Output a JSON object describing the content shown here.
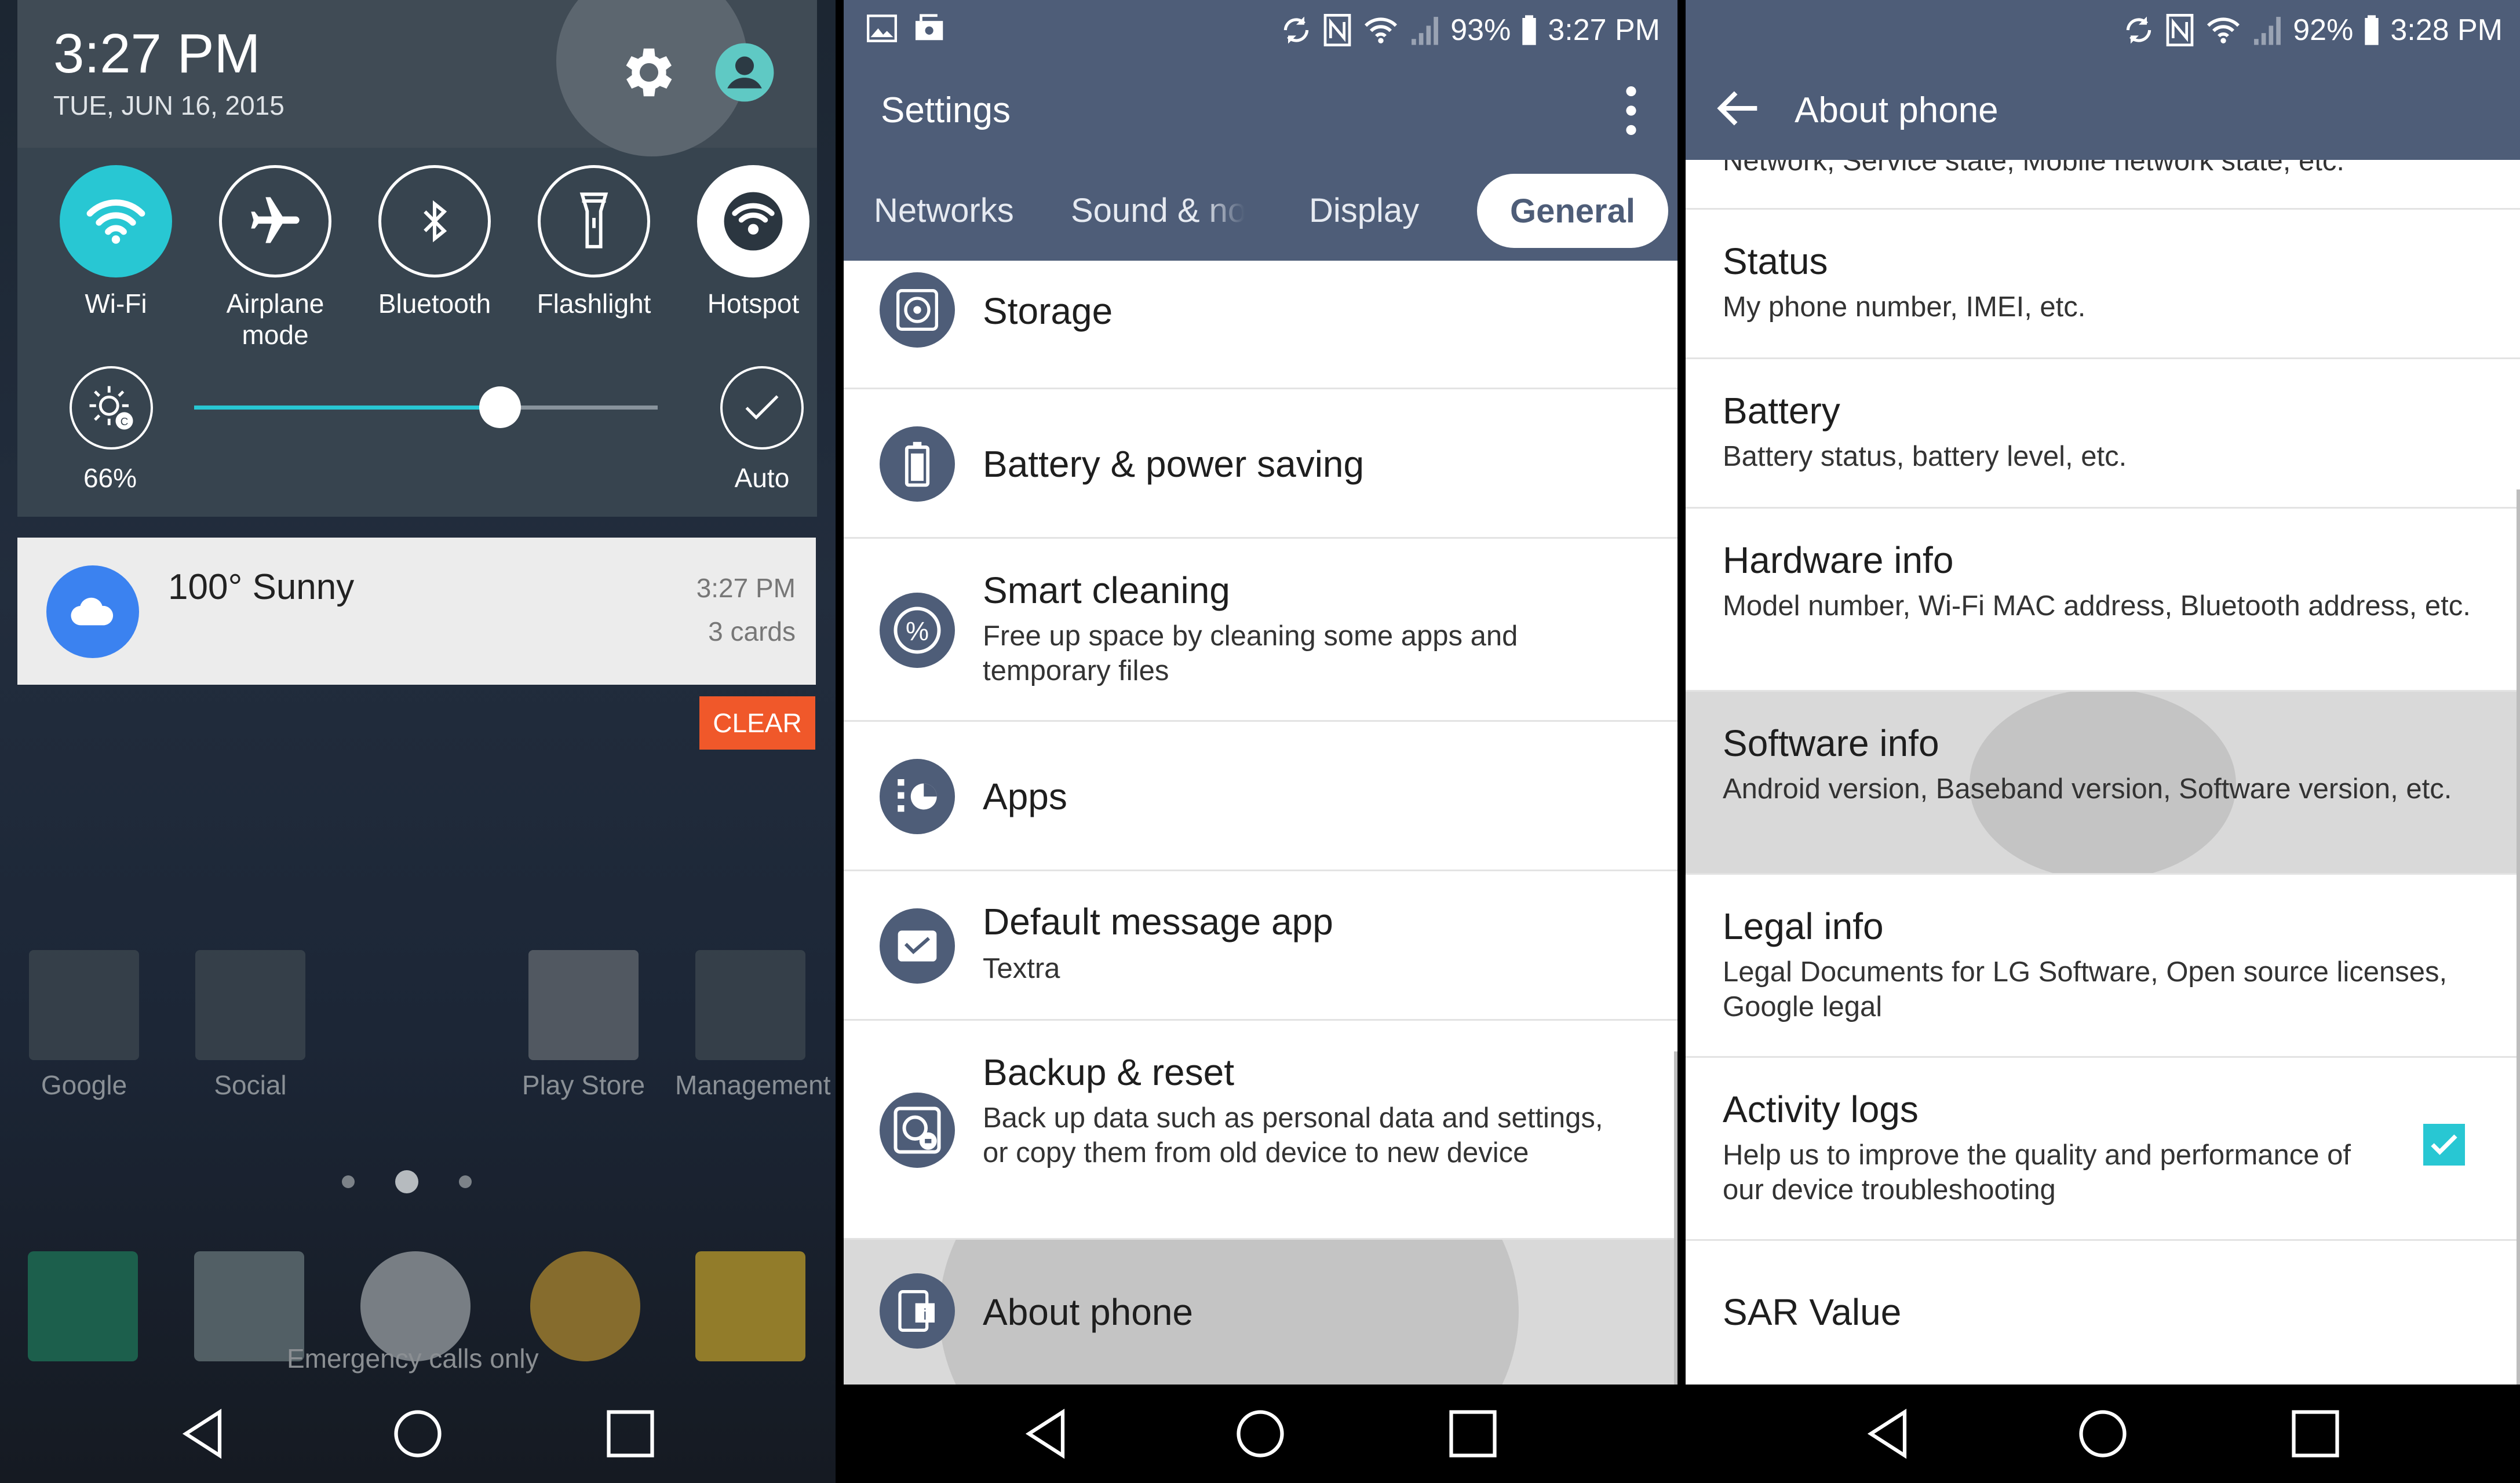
{
  "panel1": {
    "time": "3:27 PM",
    "date": "TUE, JUN 16, 2015",
    "quick_toggles": [
      {
        "label": "Wi-Fi",
        "icon": "wifi-icon",
        "active": true
      },
      {
        "label": "Airplane mode",
        "icon": "airplane-icon",
        "active": false
      },
      {
        "label": "Bluetooth",
        "icon": "bluetooth-icon",
        "active": false
      },
      {
        "label": "Flashlight",
        "icon": "flashlight-icon",
        "active": false
      },
      {
        "label": "Hotspot",
        "icon": "hotspot-icon",
        "active": false
      }
    ],
    "brightness_percent": "66%",
    "brightness_level": 0.66,
    "auto_label": "Auto",
    "notification": {
      "title": "100° Sunny",
      "time": "3:27 PM",
      "cards": "3 cards"
    },
    "clear_label": "CLEAR",
    "home_apps": [
      {
        "label": "Google"
      },
      {
        "label": "Social"
      },
      {
        "label": "Play Store"
      },
      {
        "label": "Management"
      }
    ],
    "emergency": "Emergency calls only",
    "colors": {
      "accent": "#28c7d3",
      "clear": "#f0582a",
      "weather": "#3b82f0"
    }
  },
  "panel2": {
    "status": {
      "battery": "93%",
      "time": "3:27 PM"
    },
    "title": "Settings",
    "tabs": [
      "Networks",
      "Sound & no",
      "Display",
      "General"
    ],
    "active_tab": "General",
    "items": [
      {
        "title": "Storage",
        "sub": "",
        "icon": "storage-icon"
      },
      {
        "title": "Battery & power saving",
        "sub": "",
        "icon": "battery-icon"
      },
      {
        "title": "Smart cleaning",
        "sub": "Free up space by cleaning some apps and temporary files",
        "icon": "percent-icon"
      },
      {
        "title": "Apps",
        "sub": "",
        "icon": "apps-icon"
      },
      {
        "title": "Default message app",
        "sub": "Textra",
        "icon": "message-icon"
      },
      {
        "title": "Backup & reset",
        "sub": "Back up data such as personal data and settings, or copy them from old device to new device",
        "icon": "backup-icon"
      },
      {
        "title": "About phone",
        "sub": "",
        "icon": "about-phone-icon"
      }
    ],
    "colors": {
      "header": "#4e5d78"
    }
  },
  "panel3": {
    "status": {
      "battery": "92%",
      "time": "3:28 PM"
    },
    "title": "About phone",
    "partial_top": "Network, Service state, Mobile network state, etc.",
    "items": [
      {
        "title": "Status",
        "sub": "My phone number, IMEI, etc."
      },
      {
        "title": "Battery",
        "sub": "Battery status, battery level, etc."
      },
      {
        "title": "Hardware info",
        "sub": "Model number, Wi-Fi MAC address, Bluetooth address, etc."
      },
      {
        "title": "Software info",
        "sub": "Android version, Baseband version, Software version, etc."
      },
      {
        "title": "Legal info",
        "sub": "Legal Documents for LG Software, Open source licenses, Google legal"
      },
      {
        "title": "Activity logs",
        "sub": "Help us to improve the quality and performance of our device troubleshooting"
      },
      {
        "title": "SAR Value",
        "sub": ""
      }
    ],
    "activity_logs_checked": true
  }
}
